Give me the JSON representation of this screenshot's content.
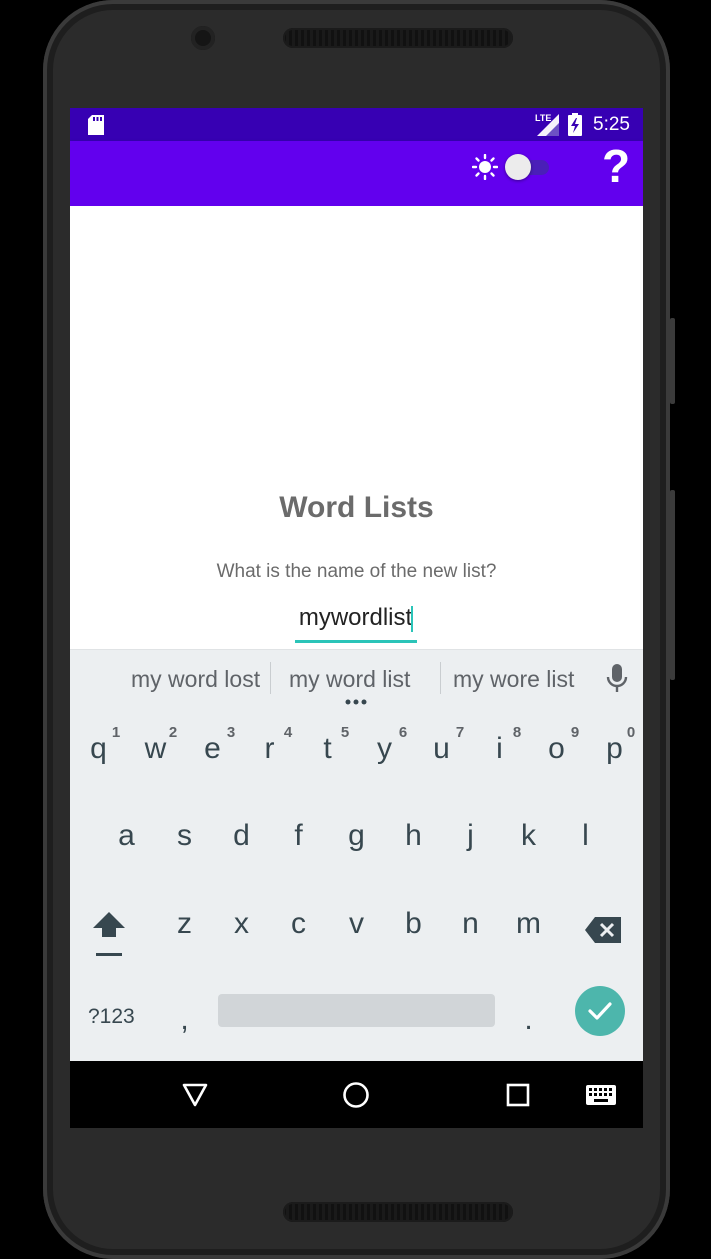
{
  "status_bar": {
    "network": "LTE",
    "time": "5:25"
  },
  "app_bar": {
    "theme_toggle": "off",
    "help_label": "?"
  },
  "main": {
    "title": "Word Lists",
    "prompt": "What is the name of the new list?",
    "input_value": "mywordlist"
  },
  "suggestions": [
    "my word lost",
    "my word list",
    "my wore list"
  ],
  "keyboard": {
    "row1": [
      "q",
      "w",
      "e",
      "r",
      "t",
      "y",
      "u",
      "i",
      "o",
      "p"
    ],
    "row1_numbers": [
      "1",
      "2",
      "3",
      "4",
      "5",
      "6",
      "7",
      "8",
      "9",
      "0"
    ],
    "row2": [
      "a",
      "s",
      "d",
      "f",
      "g",
      "h",
      "j",
      "k",
      "l"
    ],
    "row3": [
      "z",
      "x",
      "c",
      "v",
      "b",
      "n",
      "m"
    ],
    "symbols_key": "?123",
    "comma_key": ",",
    "period_key": "."
  },
  "colors": {
    "status_bar": "#3700b3",
    "app_bar": "#6200ee",
    "accent": "#2bc4b8",
    "keyboard_bg": "#eceff1"
  },
  "icons": [
    "sd-card-icon",
    "signal-icon",
    "battery-charging-icon",
    "sun-icon",
    "moon-icon",
    "help-icon",
    "microphone-icon",
    "shift-icon",
    "backspace-icon",
    "checkmark-icon",
    "back-icon",
    "home-icon",
    "recents-icon",
    "keyboard-icon"
  ]
}
